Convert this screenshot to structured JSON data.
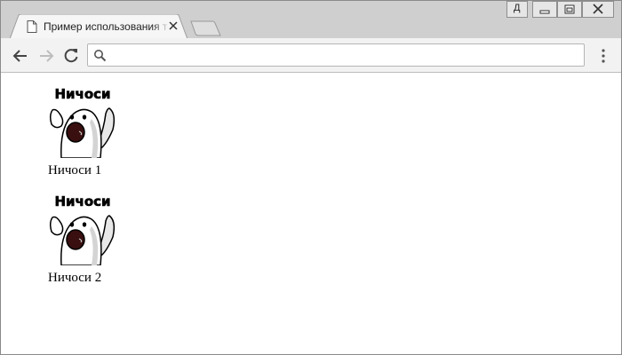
{
  "window": {
    "tab_title": "Пример использования тег",
    "user_badge": "Д"
  },
  "toolbar": {
    "address_value": "",
    "address_placeholder": ""
  },
  "page": {
    "items": [
      {
        "sticker_text": "Ничоси",
        "caption": "Ничоси 1"
      },
      {
        "sticker_text": "Ничоси",
        "caption": "Ничоси 2"
      }
    ]
  },
  "icons": [
    "document-icon",
    "close-icon",
    "back-arrow-icon",
    "forward-arrow-icon",
    "reload-icon",
    "search-icon",
    "menu-dots-icon",
    "minimize-icon",
    "maximize-icon",
    "close-window-icon"
  ]
}
